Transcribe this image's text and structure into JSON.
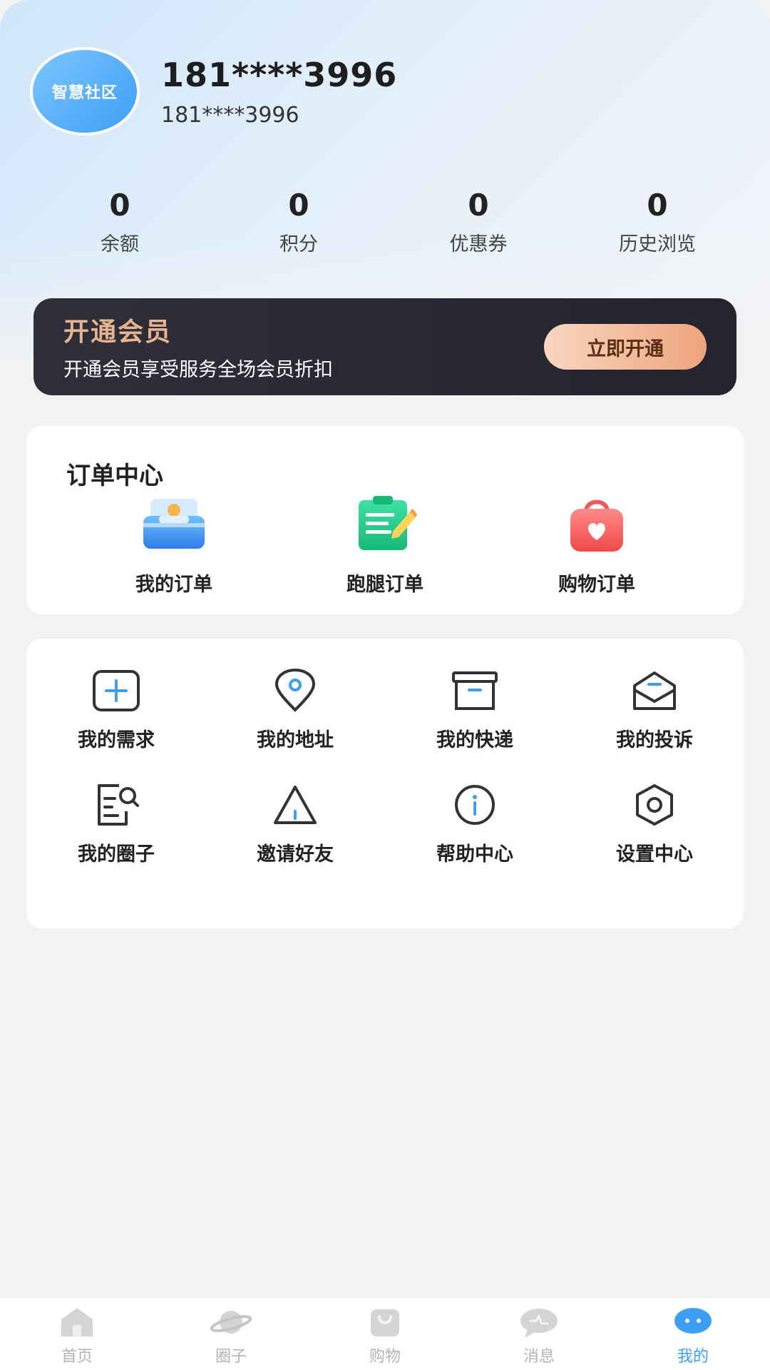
{
  "profile": {
    "avatar_text": "智慧社区",
    "name": "181****3996",
    "phone": "181****3996"
  },
  "stats": [
    {
      "value": "0",
      "label": "余额"
    },
    {
      "value": "0",
      "label": "积分"
    },
    {
      "value": "0",
      "label": "优惠券"
    },
    {
      "value": "0",
      "label": "历史浏览"
    }
  ],
  "member": {
    "title": "开通会员",
    "subtitle": "开通会员享受服务全场会员折扣",
    "button": "立即开通"
  },
  "orders": {
    "title": "订单中心",
    "items": [
      {
        "label": "我的订单",
        "icon": "wallet-icon"
      },
      {
        "label": "跑腿订单",
        "icon": "clipboard-pen-icon"
      },
      {
        "label": "购物订单",
        "icon": "shopping-bag-heart-icon"
      }
    ]
  },
  "tools": [
    {
      "label": "我的需求",
      "icon": "plus-square-icon"
    },
    {
      "label": "我的地址",
      "icon": "location-pin-icon"
    },
    {
      "label": "我的快递",
      "icon": "archive-box-icon"
    },
    {
      "label": "我的投诉",
      "icon": "envelope-open-icon"
    },
    {
      "label": "我的圈子",
      "icon": "document-search-icon"
    },
    {
      "label": "邀请好友",
      "icon": "triangle-alert-icon"
    },
    {
      "label": "帮助中心",
      "icon": "info-circle-icon"
    },
    {
      "label": "设置中心",
      "icon": "hexagon-settings-icon"
    }
  ],
  "tabbar": [
    {
      "label": "首页",
      "icon": "home-icon",
      "active": false
    },
    {
      "label": "圈子",
      "icon": "planet-icon",
      "active": false
    },
    {
      "label": "购物",
      "icon": "shopping-bag-icon",
      "active": false
    },
    {
      "label": "消息",
      "icon": "chat-bubble-icon",
      "active": false
    },
    {
      "label": "我的",
      "icon": "profile-face-icon",
      "active": true
    }
  ],
  "colors": {
    "accent": "#3d9ef5",
    "member_title": "#e8b48f",
    "member_bg": "#2a2a35",
    "inactive_tab": "#b3b3b3"
  }
}
